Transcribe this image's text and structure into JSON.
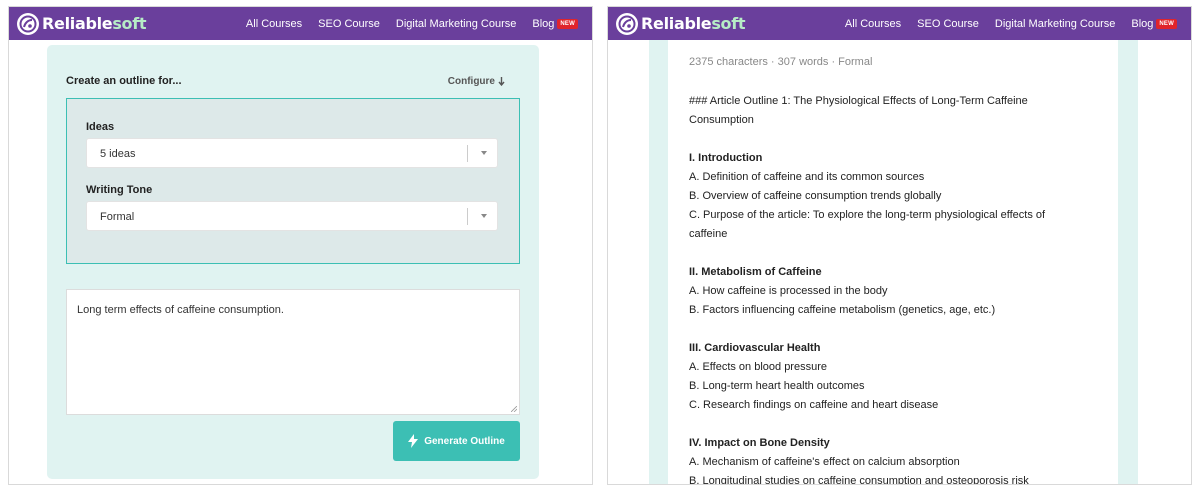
{
  "brand": {
    "name_reliable": "Reliable",
    "name_soft": "soft"
  },
  "nav": {
    "all_courses": "All Courses",
    "seo_course": "SEO Course",
    "digital_marketing": "Digital Marketing Course",
    "blog": "Blog",
    "new_badge": "NEW"
  },
  "form": {
    "title": "Create an outline for...",
    "configure_label": "Configure",
    "ideas_label": "Ideas",
    "ideas_value": "5 ideas",
    "tone_label": "Writing Tone",
    "tone_value": "Formal",
    "topic_text": "Long term effects of caffeine consumption.",
    "generate_label": "Generate Outline"
  },
  "output": {
    "meta": "2375 characters · 307 words · Formal",
    "title_line1": "### Article Outline 1: The Physiological Effects of Long-Term Caffeine",
    "title_line2": "Consumption",
    "s1_heading": "I. Introduction",
    "s1_a": "A. Definition of caffeine and its common sources",
    "s1_b": "B. Overview of caffeine consumption trends globally",
    "s1_c1": "C. Purpose of the article: To explore the long-term physiological effects of",
    "s1_c2": "caffeine",
    "s2_heading": "II. Metabolism of Caffeine",
    "s2_a": "A. How caffeine is processed in the body",
    "s2_b": "B. Factors influencing caffeine metabolism (genetics, age, etc.)",
    "s3_heading": "III. Cardiovascular Health",
    "s3_a": "A. Effects on blood pressure",
    "s3_b": "B. Long-term heart health outcomes",
    "s3_c": "C. Research findings on caffeine and heart disease",
    "s4_heading": "IV. Impact on Bone Density",
    "s4_a": "A. Mechanism of caffeine's effect on calcium absorption",
    "s4_b": "B. Longitudinal studies on caffeine consumption and osteoporosis risk"
  },
  "colors": {
    "navbar": "#6a3f9c",
    "teal_accent": "#3cbfb4",
    "card_bg": "#e0f3f1",
    "badge_red": "#e0242b"
  },
  "icons": {
    "logo": "reliablesoft-logo-icon",
    "configure": "arrow-down-icon",
    "caret": "chevron-down-icon",
    "bolt": "lightning-icon"
  }
}
